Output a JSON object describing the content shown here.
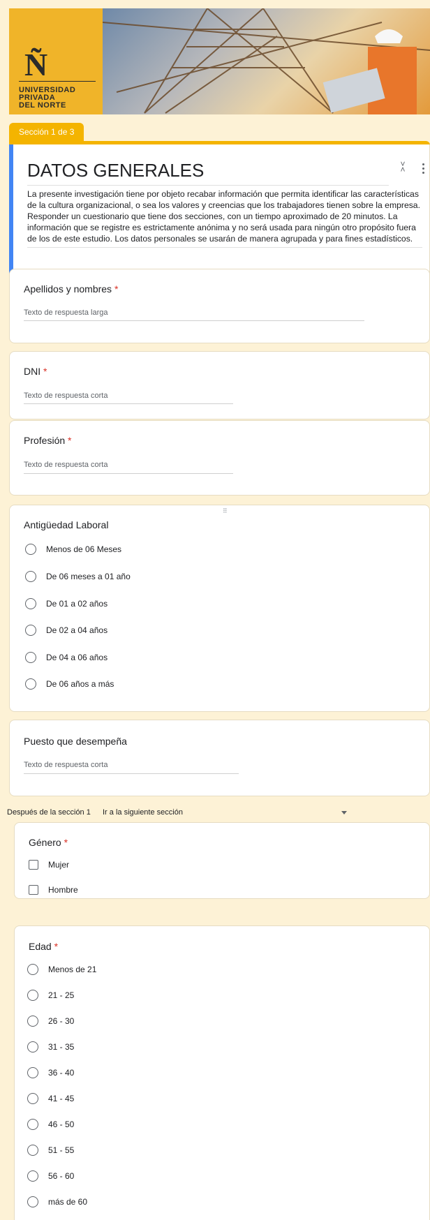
{
  "banner": {
    "logo_letter": "Ñ",
    "logo_lines": [
      "UNIVERSIDAD",
      "PRIVADA",
      "DEL NORTE"
    ]
  },
  "section_tab": "Sección 1 de 3",
  "header": {
    "title": "DATOS GENERALES",
    "description": "La presente investigación tiene por objeto recabar información que permita identificar las características de la cultura organizacional, o sea los valores y creencias que los trabajadores tienen sobre la empresa. Responder un cuestionario que tiene dos secciones, con un tiempo aproximado de 20 minutos. La información que se registre es estrictamente anónima y no será usada para ningún otro propósito fuera de los de este estudio. Los datos personales se usarán de manera agrupada y para fines estadísticos."
  },
  "questions": {
    "apellidos": {
      "title": "Apellidos y nombres",
      "required": "*",
      "placeholder": "Texto de respuesta larga"
    },
    "dni": {
      "title": "DNI",
      "required": "*",
      "placeholder": "Texto de respuesta corta"
    },
    "profesion": {
      "title": "Profesión",
      "required": "*",
      "placeholder": "Texto de respuesta corta"
    },
    "antiguedad": {
      "title": "Antigüedad Laboral",
      "options": [
        "Menos de 06 Meses",
        "De 06 meses a 01 año",
        "De 01 a 02 años",
        "De 02 a 04 años",
        "De 04 a 06 años",
        "De 06 años a más"
      ]
    },
    "puesto": {
      "title": "Puesto que desempeña",
      "placeholder": "Texto de respuesta corta"
    },
    "genero": {
      "title": "Género",
      "required": "*",
      "options": [
        "Mujer",
        "Hombre"
      ]
    },
    "edad": {
      "title": "Edad",
      "required": "*",
      "options": [
        "Menos de 21",
        "21 - 25",
        "26 - 30",
        "31 - 35",
        "36 - 40",
        "41 - 45",
        "46 - 50",
        "51 - 55",
        "56 - 60",
        "más de 60"
      ]
    }
  },
  "after_section": {
    "label": "Después de la sección 1",
    "value": "Ir a la siguiente sección"
  },
  "colors": {
    "accent": "#f4b400",
    "header_border": "#4285f4",
    "required": "#d93025"
  }
}
